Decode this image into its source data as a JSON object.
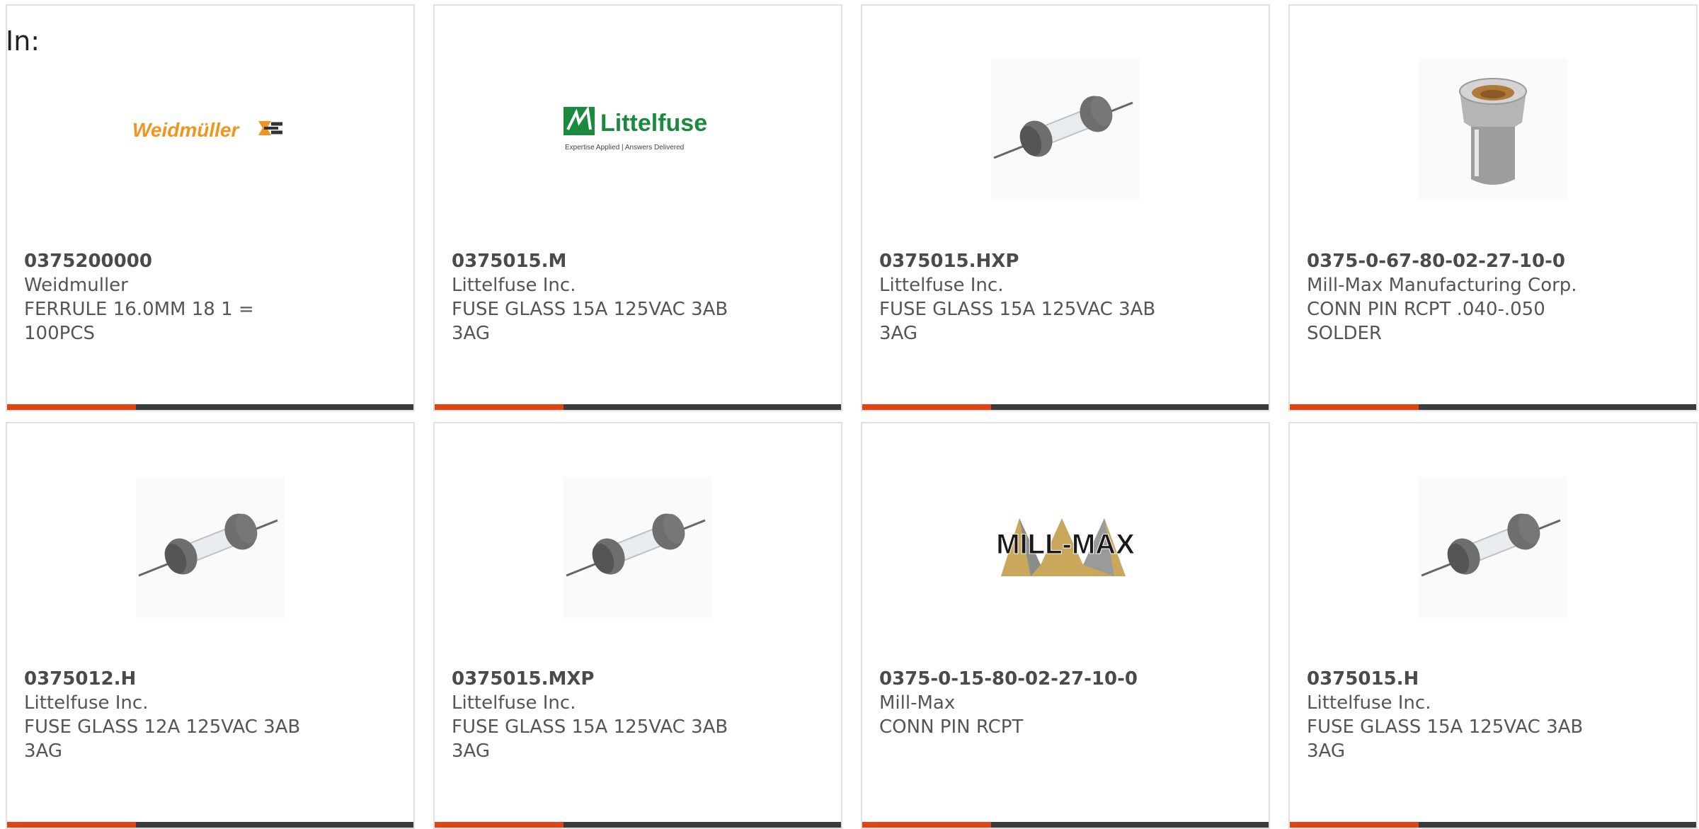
{
  "filter_label": "In:",
  "colors": {
    "accent": "#e34212",
    "bar": "#3b3b3b",
    "border": "#e0e0e0"
  },
  "products": [
    {
      "part_number": "0375200000",
      "manufacturer": "Weidmuller",
      "description": "FERRULE 16.0MM 18 1 = 100PCS",
      "image": "weidmuller-logo",
      "logo_text": "Weidmüller"
    },
    {
      "part_number": "0375015.M",
      "manufacturer": "Littelfuse Inc.",
      "description": "FUSE GLASS 15A 125VAC 3AB 3AG",
      "image": "littelfuse-logo",
      "logo_text": "Littelfuse",
      "logo_tagline": "Expertise Applied | Answers Delivered"
    },
    {
      "part_number": "0375015.HXP",
      "manufacturer": "Littelfuse Inc.",
      "description": "FUSE GLASS 15A 125VAC 3AB 3AG",
      "image": "glass-fuse-photo"
    },
    {
      "part_number": "0375-0-67-80-02-27-10-0",
      "manufacturer": "Mill-Max Manufacturing Corp.",
      "description": "CONN PIN RCPT .040-.050 SOLDER",
      "image": "pin-receptacle-photo"
    },
    {
      "part_number": "0375012.H",
      "manufacturer": "Littelfuse Inc.",
      "description": "FUSE GLASS 12A 125VAC 3AB 3AG",
      "image": "glass-fuse-photo"
    },
    {
      "part_number": "0375015.MXP",
      "manufacturer": "Littelfuse Inc.",
      "description": "FUSE GLASS 15A 125VAC 3AB 3AG",
      "image": "glass-fuse-photo"
    },
    {
      "part_number": "0375-0-15-80-02-27-10-0",
      "manufacturer": "Mill-Max",
      "description": "CONN PIN RCPT",
      "image": "mill-max-logo",
      "logo_text": "MILL-MAX"
    },
    {
      "part_number": "0375015.H",
      "manufacturer": "Littelfuse Inc.",
      "description": "FUSE GLASS 15A 125VAC 3AB 3AG",
      "image": "glass-fuse-photo"
    }
  ]
}
